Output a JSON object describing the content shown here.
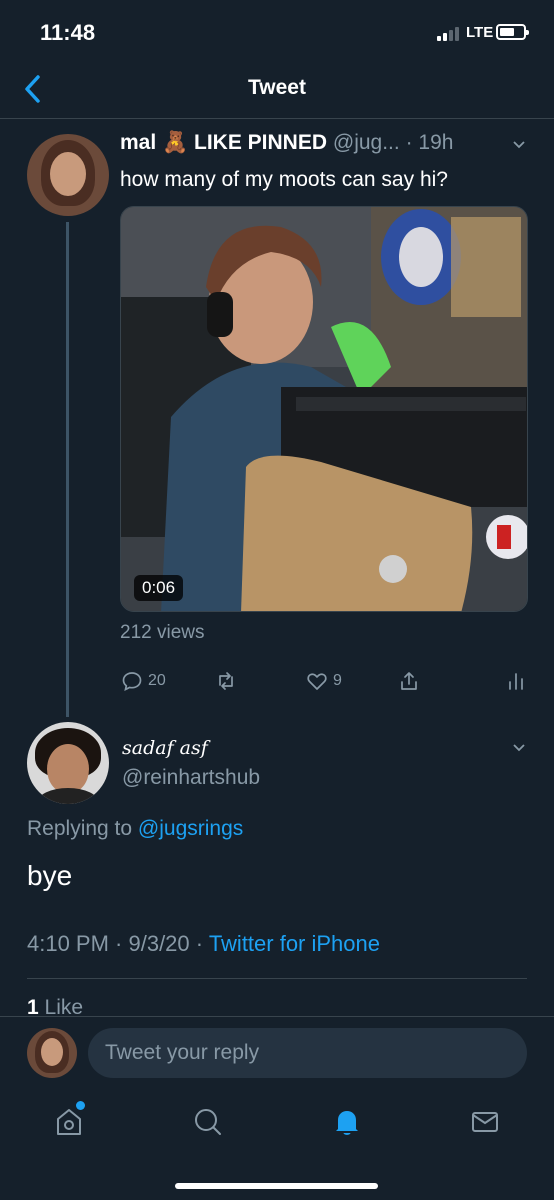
{
  "status_bar": {
    "time": "11:48",
    "network": "LTE"
  },
  "nav": {
    "title": "Tweet"
  },
  "tweet": {
    "author_name": "mal 🧸 LIKE PINNED",
    "handle": "@jug...",
    "time": "· 19h",
    "text": "how many of my moots can say hi?",
    "video_duration": "0:06",
    "views": "212 views",
    "actions": {
      "reply_count": "20",
      "retweet_count": "",
      "like_count": "9"
    }
  },
  "reply": {
    "author_name": "sadaf asf",
    "handle": "@reinhartshub",
    "replying_prefix": "Replying to ",
    "replying_handle": "@jugsrings",
    "text": "bye",
    "timestamp": "4:10 PM · 9/3/20 · ",
    "source": "Twitter for iPhone",
    "likes_count": "1",
    "likes_label": " Like"
  },
  "composer": {
    "placeholder": "Tweet your reply"
  },
  "colors": {
    "background": "#15202b",
    "accent": "#1da1f2",
    "muted": "#8899a6",
    "divider": "#38444d"
  },
  "icons": {
    "back": "chevron-left-icon",
    "reply": "comment-icon",
    "retweet": "retweet-icon",
    "like": "heart-icon",
    "share": "share-icon",
    "analytics": "analytics-icon",
    "home": "home-icon",
    "search": "search-icon",
    "notifications": "bell-icon",
    "messages": "mail-icon"
  }
}
